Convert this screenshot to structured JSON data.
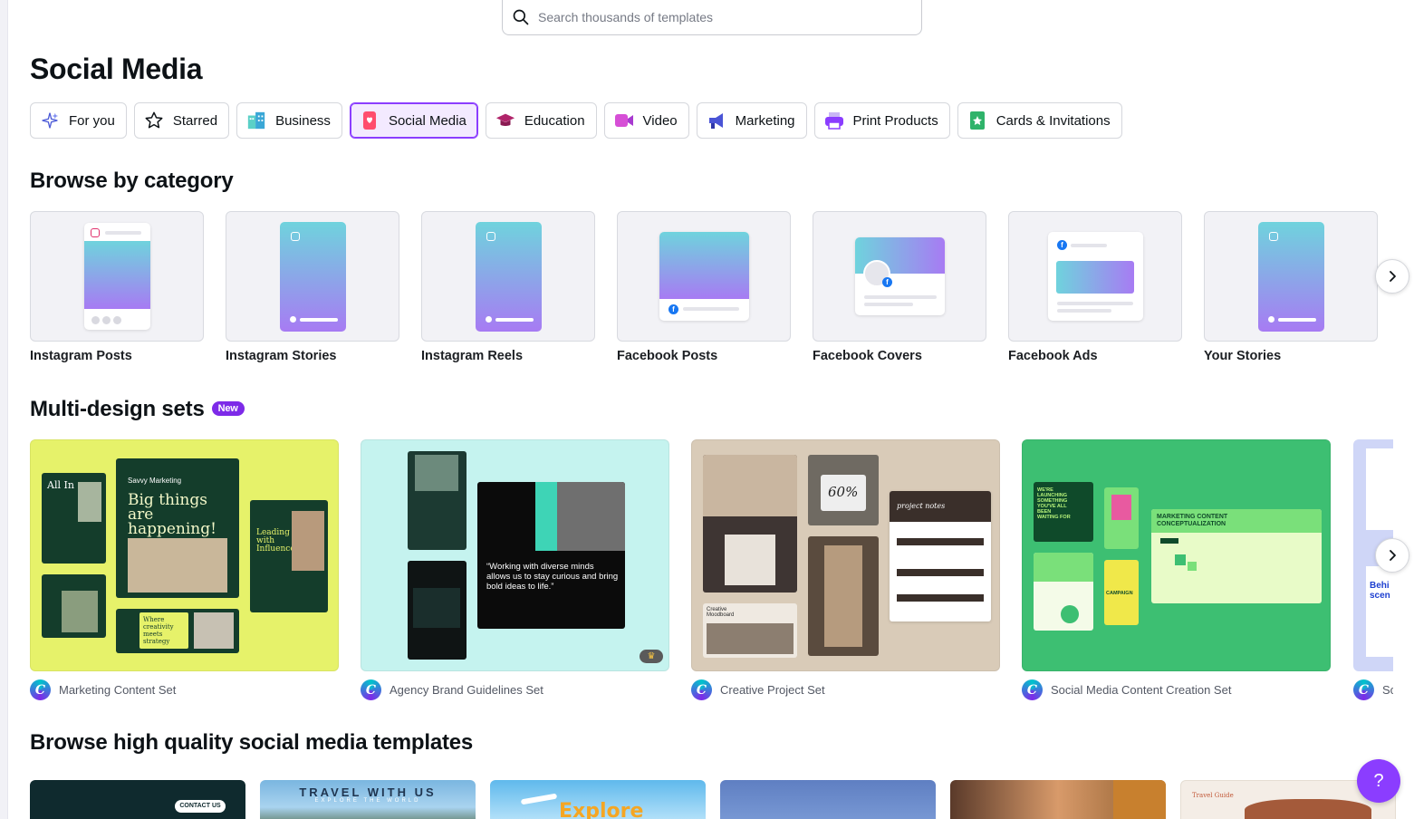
{
  "search": {
    "placeholder": "Search thousands of templates"
  },
  "page_title": "Social Media",
  "chips": [
    {
      "label": "For you",
      "icon": "sparkle-icon",
      "active": false
    },
    {
      "label": "Starred",
      "icon": "star-icon",
      "active": false
    },
    {
      "label": "Business",
      "icon": "building-icon",
      "active": false
    },
    {
      "label": "Social Media",
      "icon": "heart-phone-icon",
      "active": true
    },
    {
      "label": "Education",
      "icon": "graduation-cap-icon",
      "active": false
    },
    {
      "label": "Video",
      "icon": "video-camera-icon",
      "active": false
    },
    {
      "label": "Marketing",
      "icon": "megaphone-icon",
      "active": false
    },
    {
      "label": "Print Products",
      "icon": "printer-icon",
      "active": false
    },
    {
      "label": "Cards & Invitations",
      "icon": "card-icon",
      "active": false
    }
  ],
  "browse_title": "Browse by category",
  "categories": [
    {
      "label": "Instagram Posts"
    },
    {
      "label": "Instagram Stories"
    },
    {
      "label": "Instagram Reels"
    },
    {
      "label": "Facebook Posts"
    },
    {
      "label": "Facebook Covers"
    },
    {
      "label": "Facebook Ads"
    },
    {
      "label": "Your Stories"
    }
  ],
  "sets_title": "Multi-design sets",
  "sets_badge": "New",
  "sets": [
    {
      "label": "Marketing Content Set",
      "bg": "#e6f26a"
    },
    {
      "label": "Agency Brand Guidelines Set",
      "bg": "#c5f3ef"
    },
    {
      "label": "Creative Project Set",
      "bg": "#d9cbb8"
    },
    {
      "label": "Social Media Content Creation Set",
      "bg": "#3dbf72"
    },
    {
      "label": "Sc"
    }
  ],
  "set_texts": {
    "big_things": "Big things are happening!",
    "savvy": "Savvy Marketing",
    "all_in": "All In",
    "leading": "Leading with Influence",
    "where": "Where creativity meets strategy",
    "quote": "“Working with diverse minds allows us to stay curious and bring bold ideas to life.”",
    "percent": "60%",
    "project_notes": "project notes",
    "moodboard": "Creative Moodboard",
    "mc_title": "MARKETING CONTENT CONCEPTUALIZATION",
    "launching": "WE'RE LAUNCHING SOMETHING YOU'VE ALL BEEN WAITING FOR",
    "campaign": "CAMPAIGN",
    "behind": "Behi scen"
  },
  "templates_title": "Browse high quality social media templates",
  "template_texts": {
    "contact": "CONTACT US",
    "travel": "TRAVEL WITH US",
    "explore_world": "EXPLORE THE WORLD",
    "explore": "Explore",
    "travel_guide": "Travel Guide"
  },
  "help_label": "?",
  "colors": {
    "accent": "#8b3dff",
    "badge": "#7d2ae8"
  }
}
